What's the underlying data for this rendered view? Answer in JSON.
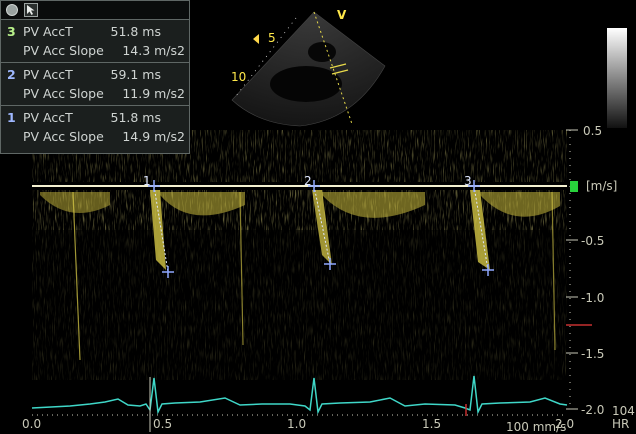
{
  "panel": {
    "groups": [
      {
        "index": "3",
        "acct_label": "PV AccT",
        "acct_value": "51.8 ms",
        "slope_label": "PV Acc Slope",
        "slope_value": "14.3 m/s2"
      },
      {
        "index": "2",
        "acct_label": "PV AccT",
        "acct_value": "59.1 ms",
        "slope_label": "PV Acc Slope",
        "slope_value": "11.9 m/s2"
      },
      {
        "index": "1",
        "acct_label": "PV AccT",
        "acct_value": "51.8 ms",
        "slope_label": "PV Acc Slope",
        "slope_value": "14.9 m/s2"
      }
    ]
  },
  "sector": {
    "marker": "V",
    "depth_marks": [
      "5",
      "10"
    ]
  },
  "doppler": {
    "unit": "[m/s]",
    "y_ticks": [
      "0.5",
      "-0.5",
      "-1.0",
      "-1.5",
      "-2.0"
    ],
    "x_ticks": [
      "0.0",
      "0.5",
      "1.0",
      "1.5",
      "2.0"
    ],
    "sweep_speed": "100 mm/s",
    "hr_value": "104",
    "hr_label": "HR",
    "caliper_labels": [
      "1",
      "2",
      "3"
    ]
  },
  "colors": {
    "doppler": "#e2d34a",
    "baseline": "#f3f0d0",
    "ecg": "#3fd7c8",
    "caliper": "#8fa8ff",
    "scale_marker": "#28d23c"
  }
}
